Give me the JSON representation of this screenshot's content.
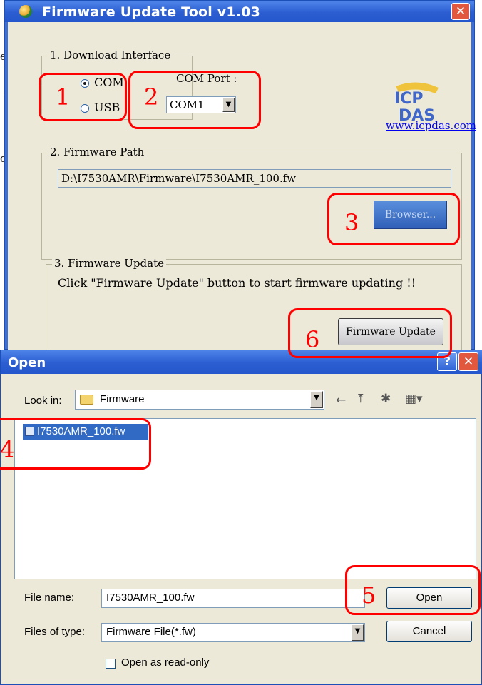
{
  "firmware_tool": {
    "title": "Firmware Update Tool v1.03",
    "download_interface": {
      "legend": "1. Download Interface",
      "radio_com": "COM",
      "radio_usb": "USB",
      "com_port_label": "COM Port :",
      "com_port_value": "COM1"
    },
    "logo_text": "ICP DAS",
    "website": "www.icpdas.com",
    "firmware_path": {
      "legend": "2. Firmware Path",
      "path": "D:\\I7530AMR\\Firmware\\I7530AMR_100.fw",
      "browse_button": "Browser..."
    },
    "firmware_update": {
      "legend": "3. Firmware Update",
      "instruction": "Click  \"Firmware Update\" button to start firmware updating !!",
      "update_button": "Firmware Update"
    }
  },
  "open_dialog": {
    "title": "Open",
    "look_in_label": "Look in:",
    "look_in_value": "Firmware",
    "files": [
      "I7530AMR_100.fw"
    ],
    "file_name_label": "File name:",
    "file_name_value": "I7530AMR_100.fw",
    "files_of_type_label": "Files of type:",
    "files_of_type_value": "Firmware File(*.fw)",
    "open_button": "Open",
    "cancel_button": "Cancel",
    "read_only_label": "Open as read-only"
  },
  "annotations": [
    "1",
    "2",
    "3",
    "4",
    "5",
    "6"
  ],
  "background_page": {
    "letter_e": "e",
    "letter_c": "c"
  },
  "colors": {
    "title_bar": "#2c5ed2",
    "dialog_face": "#ece9d8",
    "annotation_red": "#ff0000",
    "close_button": "#e1583f"
  }
}
